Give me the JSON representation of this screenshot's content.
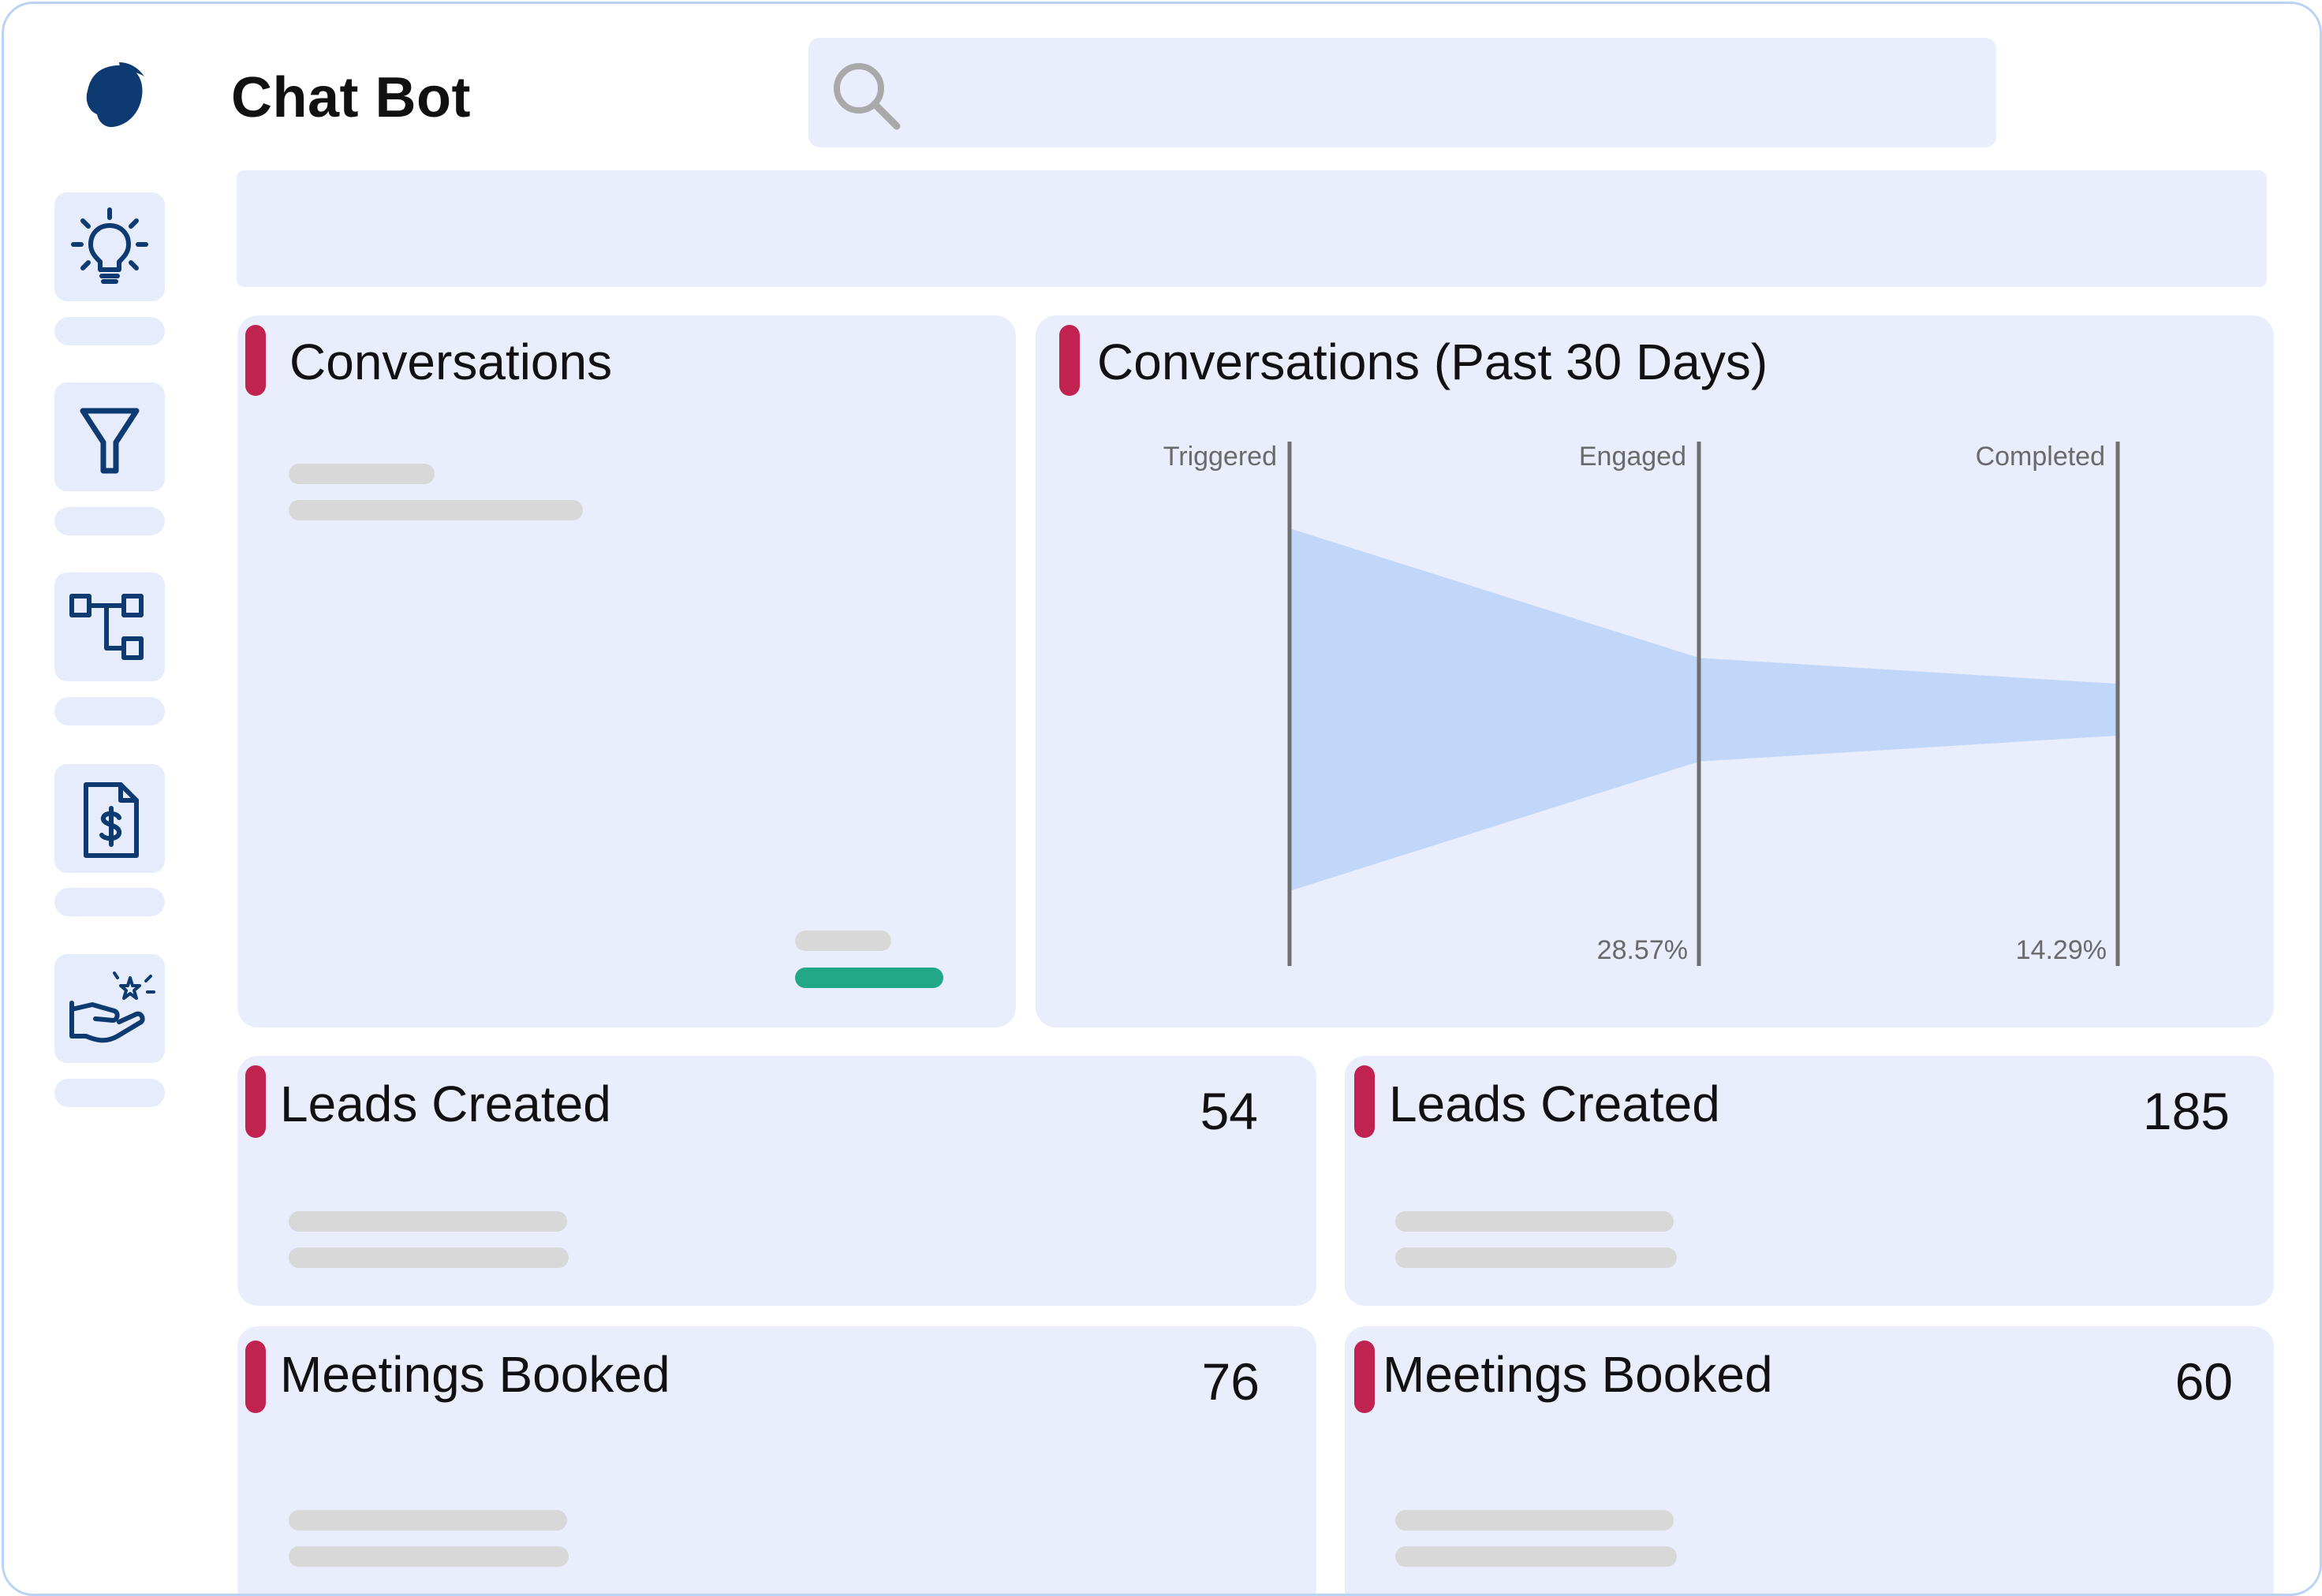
{
  "app": {
    "title": "Chat Bot"
  },
  "search": {
    "placeholder": ""
  },
  "sidebar": {
    "items": [
      {
        "icon": "lightbulb-icon"
      },
      {
        "icon": "filter-icon"
      },
      {
        "icon": "flowchart-icon"
      },
      {
        "icon": "invoice-icon"
      },
      {
        "icon": "hand-sparkle-icon"
      }
    ]
  },
  "cards": {
    "conversations": {
      "title": "Conversations"
    },
    "conversations_30d": {
      "title": "Conversations (Past 30 Days)"
    },
    "leads_1": {
      "title": "Leads Created",
      "value": "54"
    },
    "leads_2": {
      "title": "Leads Created",
      "value": "185"
    },
    "meetings_1": {
      "title": "Meetings Booked",
      "value": "76"
    },
    "meetings_2": {
      "title": "Meetings Booked",
      "value": "60"
    }
  },
  "colors": {
    "accent": "#c0234f",
    "card_bg": "#e9edfc",
    "funnel_fill": "#c0d7fa",
    "progress": "#22a887",
    "brand": "#0e3a72"
  },
  "chart_data": {
    "type": "area",
    "title": "Conversations (Past 30 Days)",
    "stages": [
      "Triggered",
      "Engaged",
      "Completed"
    ],
    "values": [
      100,
      28.57,
      14.29
    ],
    "percent_labels": [
      "",
      "28.57%",
      "14.29%"
    ],
    "unit": "%"
  }
}
